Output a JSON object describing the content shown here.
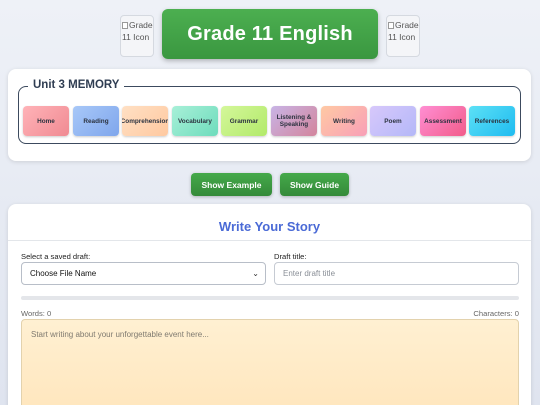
{
  "header": {
    "title": "Grade 11 English",
    "left_icon_alt": "Grade 11 Icon",
    "right_icon_alt": "Grade 11 Icon"
  },
  "unit": {
    "legend": "Unit 3 MEMORY",
    "nav": [
      {
        "label": "Home",
        "gradient": [
          "#ffb3b8",
          "#f08a92"
        ]
      },
      {
        "label": "Reading",
        "gradient": [
          "#a8c8f8",
          "#7fa6ec"
        ]
      },
      {
        "label": "Comprehension",
        "gradient": [
          "#ffe0c4",
          "#ffc9a0"
        ]
      },
      {
        "label": "Vocabulary",
        "gradient": [
          "#a8f0d8",
          "#6edcbc"
        ]
      },
      {
        "label": "Grammar",
        "gradient": [
          "#d4f79a",
          "#b2ea6a"
        ]
      },
      {
        "label": "Listening & Speaking",
        "gradient": [
          "#c8b4e6",
          "#d3859c"
        ]
      },
      {
        "label": "Writing",
        "gradient": [
          "#ffc9a4",
          "#f89fb7"
        ]
      },
      {
        "label": "Poem",
        "gradient": [
          "#d7c8fb",
          "#b4b8f8"
        ]
      },
      {
        "label": "Assessment",
        "gradient": [
          "#ff8ed3",
          "#f25c8a"
        ]
      },
      {
        "label": "References",
        "gradient": [
          "#5ce1f6",
          "#1fbbf0"
        ]
      }
    ]
  },
  "actions": {
    "show_example": "Show Example",
    "show_guide": "Show Guide"
  },
  "story": {
    "title": "Write Your Story",
    "draft_label": "Select a saved draft:",
    "draft_selected": "Choose File Name",
    "draft_title_label": "Draft title:",
    "draft_title_placeholder": "Enter draft title",
    "progress": 0,
    "words_text": "Words: 0",
    "chars_text": "Characters: 0",
    "textarea_placeholder": "Start writing about your unforgettable event here..."
  },
  "colors": {
    "accent_green": "#4caf50",
    "title_blue": "#4a6ad6"
  }
}
